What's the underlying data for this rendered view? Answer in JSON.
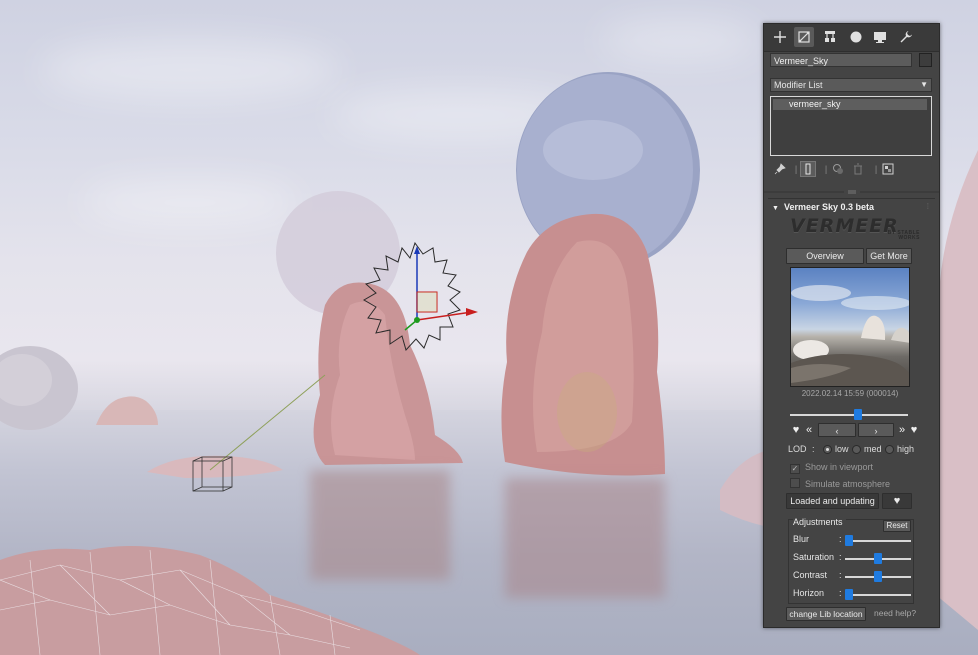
{
  "panel": {
    "tabs": [
      {
        "icon": "create-plus-icon"
      },
      {
        "icon": "modify-icon",
        "active": true
      },
      {
        "icon": "hierarchy-icon"
      },
      {
        "icon": "motion-icon"
      },
      {
        "icon": "display-icon"
      },
      {
        "icon": "utilities-wrench-icon"
      }
    ],
    "object_name": "Vermeer_Sky",
    "modifier_list": "Modifier List",
    "stack_item": "vermeer_sky"
  },
  "rollout": {
    "title": "Vermeer Sky 0.3 beta",
    "logo_word": "VERMEER",
    "logo_sub_1": "BY STABLE",
    "logo_sub_2": "WORKS",
    "overview_label": "Overview",
    "getmore_label": "Get More",
    "preview_caption": "2022.02.14 15:59 (000014)",
    "timeline_position": 0.58,
    "lod_label": "LOD",
    "lod_colon": ":",
    "lod_options": [
      "low",
      "med",
      "high"
    ],
    "lod_selected": "low",
    "show_in_viewport": "Show in viewport",
    "simulate_atmosphere": "Simulate atmosphere",
    "status_label": "Loaded and updating",
    "adjustments": {
      "title": "Adjustments",
      "reset_label": "Reset",
      "blur_label": "Blur",
      "blur_value": 0.0,
      "saturation_label": "Saturation",
      "saturation_value": 0.5,
      "contrast_label": "Contrast",
      "contrast_value": 0.5,
      "horizon_label": "Horizon",
      "horizon_value": 0.0,
      "colon": ":"
    },
    "change_lib_label": "change Lib location",
    "need_help_label": "need help?"
  },
  "colors": {
    "panel_bg": "#444444",
    "slider_blue": "#1f7be0",
    "stack_border": "#d9d9d9"
  }
}
